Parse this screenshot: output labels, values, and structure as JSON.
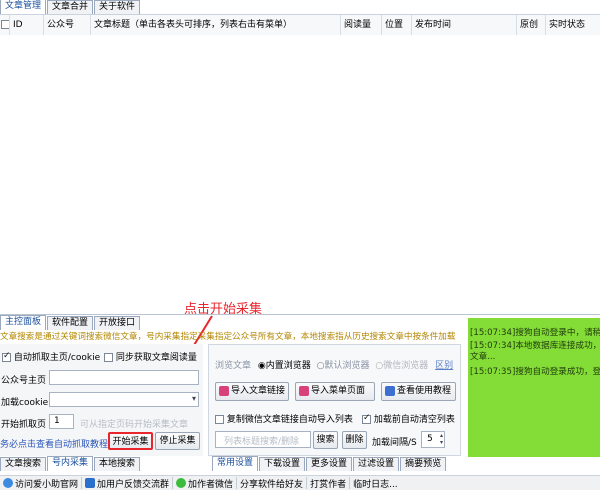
{
  "top_tabs": [
    "文章管理",
    "文章合并",
    "关于软件"
  ],
  "columns": {
    "id": "ID",
    "account": "公众号",
    "title": "文章标题（单击各表头可排序，列表右击有菜单）",
    "reads": "阅读量",
    "position": "位置",
    "publish_time": "发布时间",
    "original": "原创",
    "realtime_status": "实时状态"
  },
  "annotation": "点击开始采集",
  "control_tabs": [
    "主控面板",
    "软件配置",
    "开放接口"
  ],
  "banner_text": "文章搜索是通过关键词搜索微信文章，号内采集指定采集指定公众号所有文章，本地搜索指从历史搜索文章中按条件加载",
  "left": {
    "auto_grab_label": "自动抓取主页/cookie",
    "sync_reads_label": "同步获取文章阅读量",
    "home_label": "公众号主页",
    "cookie_label": "加载cookie",
    "pages_label": "开始抓取页",
    "pages_value": "1",
    "pages_hint": "可从指定页码开始采集文章",
    "tip": "务必点击查看自动抓取教程",
    "start_button": "开始采集",
    "stop_button": "停止采集",
    "bottom_tabs": [
      "文章搜索",
      "号内采集",
      "本地搜索"
    ]
  },
  "mid": {
    "browser_label": "浏览文章",
    "radio_builtin": "内置浏览器",
    "radio_default": "默认浏览器",
    "radio_wechat": "微信浏览器",
    "distinguish": "区别",
    "import_link_button": "导入文章链接",
    "import_menu_button": "导入菜单页面",
    "tutorial_button": "查看使用教程",
    "copy_link_label": "复制微信文章链接自动导入列表",
    "clear_list_label": "加载前自动清空列表",
    "search_placeholder": "列表标题搜索/删除",
    "search_button": "搜索",
    "delete_button": "删除",
    "interval_label": "加载间隔/S",
    "interval_value": "5",
    "bottom_tabs": [
      "常用设置",
      "下载设置",
      "更多设置",
      "过滤设置",
      "摘要预览"
    ]
  },
  "log": {
    "entries": [
      {
        "time": "[15:07:34]",
        "text": "搜狗自动登录中，请稍"
      },
      {
        "time": "[15:07:34]",
        "text": "本地数据库连接成功，"
      },
      {
        "time": "",
        "text": "文章..."
      },
      {
        "time": "[15:07:35]",
        "text": "搜狗自动登录成功，登"
      }
    ]
  },
  "status_bar": [
    "访问爱小助官网",
    "加用户反馈交流群",
    "加作者微信",
    "分享软件给好友",
    "打赏作者",
    "临时日志..."
  ],
  "colors": {
    "accent": "#1a4f9c",
    "annotation": "#e8262c",
    "log_bg": "#84dc36",
    "banner": "#b38600"
  }
}
